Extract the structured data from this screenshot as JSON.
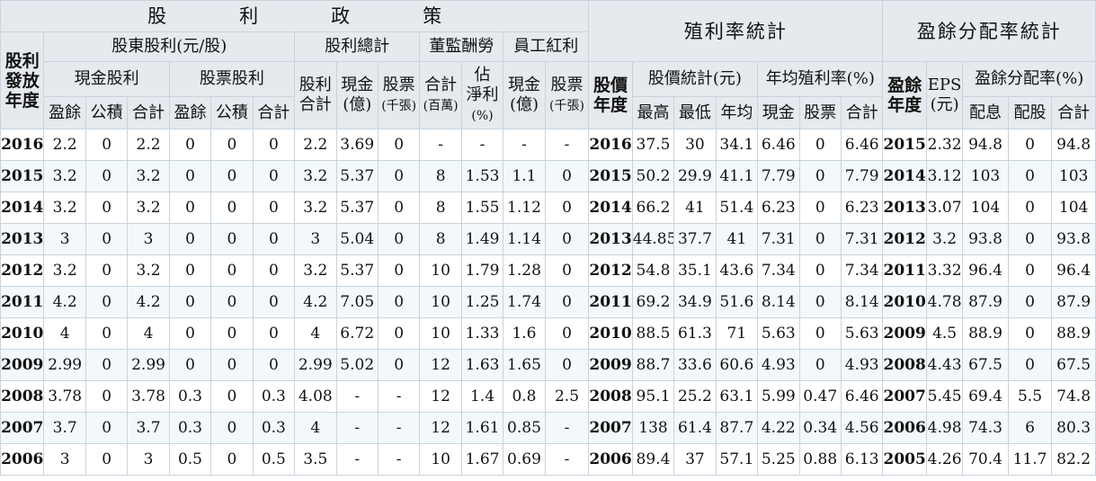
{
  "header": {
    "policy": "股　利　政　策",
    "yield_stats": "殖利率統計",
    "payout_stats": "盈餘分配率統計",
    "div_year_l1": "股利",
    "div_year_l2": "發放",
    "div_year_l3": "年度",
    "shareholder_div": "股東股利(元/股)",
    "div_total": "股利總計",
    "director_comp": "董監酬勞",
    "employee_bonus": "員工紅利",
    "price_year_l1": "股價",
    "price_year_l2": "年度",
    "price_stats": "股價統計(元)",
    "avg_yield": "年均殖利率(%)",
    "earn_year_l1": "盈餘",
    "earn_year_l2": "年度",
    "eps_l1": "EPS",
    "eps_l2": "(元)",
    "payout_ratio": "盈餘分配率(%)",
    "cash_div": "現金股利",
    "stock_div": "股票股利",
    "div_sum_l1": "股利",
    "div_sum_l2": "合計",
    "cash_l1": "現金",
    "cash_l2": "(億)",
    "stock_l1": "股票",
    "stock_l2": "(千張)",
    "dir_total_l1": "合計",
    "dir_total_l2": "(百萬)",
    "est_net_l1": "佔",
    "est_net_l2": "淨利",
    "est_net_l3": "(%)",
    "emp_cash_l1": "現金",
    "emp_cash_l2": "(億)",
    "emp_stock_l1": "股票",
    "emp_stock_l2": "(千張)",
    "surplus": "盈餘",
    "reserve": "公積",
    "subtotal": "合計",
    "high": "最高",
    "low": "最低",
    "avg": "年均",
    "cash": "現金",
    "stock": "股票",
    "total": "合計",
    "payout_cash": "配息",
    "payout_stock": "配股",
    "payout_total": "合計"
  },
  "rows": [
    [
      "2016",
      "2.2",
      "0",
      "2.2",
      "0",
      "0",
      "0",
      "2.2",
      "3.69",
      "0",
      "-",
      "-",
      "-",
      "-",
      "2016",
      "37.5",
      "30",
      "34.1",
      "6.46",
      "0",
      "6.46",
      "2015",
      "2.32",
      "94.8",
      "0",
      "94.8"
    ],
    [
      "2015",
      "3.2",
      "0",
      "3.2",
      "0",
      "0",
      "0",
      "3.2",
      "5.37",
      "0",
      "8",
      "1.53",
      "1.1",
      "0",
      "2015",
      "50.2",
      "29.9",
      "41.1",
      "7.79",
      "0",
      "7.79",
      "2014",
      "3.12",
      "103",
      "0",
      "103"
    ],
    [
      "2014",
      "3.2",
      "0",
      "3.2",
      "0",
      "0",
      "0",
      "3.2",
      "5.37",
      "0",
      "8",
      "1.55",
      "1.12",
      "0",
      "2014",
      "66.2",
      "41",
      "51.4",
      "6.23",
      "0",
      "6.23",
      "2013",
      "3.07",
      "104",
      "0",
      "104"
    ],
    [
      "2013",
      "3",
      "0",
      "3",
      "0",
      "0",
      "0",
      "3",
      "5.04",
      "0",
      "8",
      "1.49",
      "1.14",
      "0",
      "2013",
      "44.85",
      "37.7",
      "41",
      "7.31",
      "0",
      "7.31",
      "2012",
      "3.2",
      "93.8",
      "0",
      "93.8"
    ],
    [
      "2012",
      "3.2",
      "0",
      "3.2",
      "0",
      "0",
      "0",
      "3.2",
      "5.37",
      "0",
      "10",
      "1.79",
      "1.28",
      "0",
      "2012",
      "54.8",
      "35.1",
      "43.6",
      "7.34",
      "0",
      "7.34",
      "2011",
      "3.32",
      "96.4",
      "0",
      "96.4"
    ],
    [
      "2011",
      "4.2",
      "0",
      "4.2",
      "0",
      "0",
      "0",
      "4.2",
      "7.05",
      "0",
      "10",
      "1.25",
      "1.74",
      "0",
      "2011",
      "69.2",
      "34.9",
      "51.6",
      "8.14",
      "0",
      "8.14",
      "2010",
      "4.78",
      "87.9",
      "0",
      "87.9"
    ],
    [
      "2010",
      "4",
      "0",
      "4",
      "0",
      "0",
      "0",
      "4",
      "6.72",
      "0",
      "10",
      "1.33",
      "1.6",
      "0",
      "2010",
      "88.5",
      "61.3",
      "71",
      "5.63",
      "0",
      "5.63",
      "2009",
      "4.5",
      "88.9",
      "0",
      "88.9"
    ],
    [
      "2009",
      "2.99",
      "0",
      "2.99",
      "0",
      "0",
      "0",
      "2.99",
      "5.02",
      "0",
      "12",
      "1.63",
      "1.65",
      "0",
      "2009",
      "88.7",
      "33.6",
      "60.6",
      "4.93",
      "0",
      "4.93",
      "2008",
      "4.43",
      "67.5",
      "0",
      "67.5"
    ],
    [
      "2008",
      "3.78",
      "0",
      "3.78",
      "0.3",
      "0",
      "0.3",
      "4.08",
      "-",
      "-",
      "12",
      "1.4",
      "0.8",
      "2.5",
      "2008",
      "95.1",
      "25.2",
      "63.1",
      "5.99",
      "0.47",
      "6.46",
      "2007",
      "5.45",
      "69.4",
      "5.5",
      "74.8"
    ],
    [
      "2007",
      "3.7",
      "0",
      "3.7",
      "0.3",
      "0",
      "0.3",
      "4",
      "-",
      "-",
      "12",
      "1.61",
      "0.85",
      "-",
      "2007",
      "138",
      "61.4",
      "87.7",
      "4.22",
      "0.34",
      "4.56",
      "2006",
      "4.98",
      "74.3",
      "6",
      "80.3"
    ],
    [
      "2006",
      "3",
      "0",
      "3",
      "0.5",
      "0",
      "0.5",
      "3.5",
      "-",
      "-",
      "10",
      "1.67",
      "0.69",
      "-",
      "2006",
      "89.4",
      "37",
      "57.1",
      "5.25",
      "0.88",
      "6.13",
      "2005",
      "4.26",
      "70.4",
      "11.7",
      "82.2"
    ]
  ]
}
